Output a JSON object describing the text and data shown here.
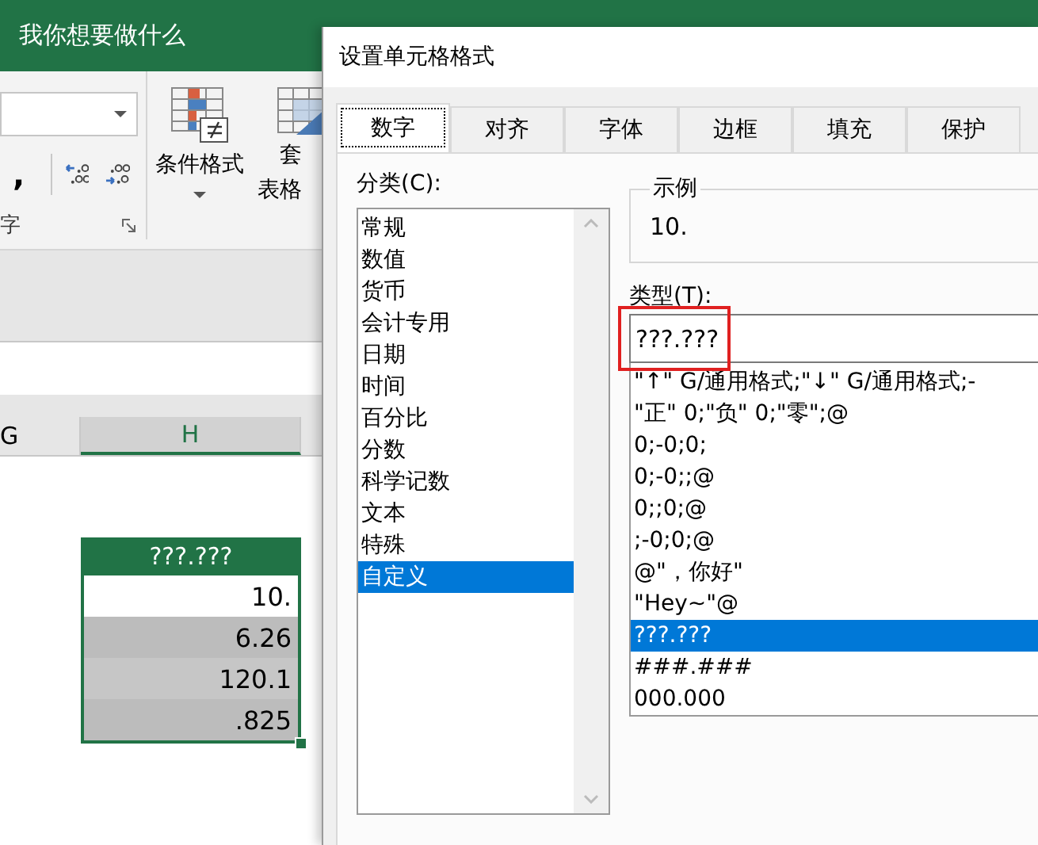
{
  "excel": {
    "tell_me": "我你想要做什么",
    "ribbon": {
      "comma_button": ",",
      "group_label": "字",
      "conditional_format": {
        "label": "条件格式"
      },
      "table_format": {
        "label_line1": "套",
        "label_line2": "表格"
      }
    },
    "column_headers": [
      {
        "label": "G",
        "selected": false
      },
      {
        "label": "H",
        "selected": true
      }
    ],
    "header_cell": "???.???",
    "cells": [
      {
        "text": "10.",
        "selected": false
      },
      {
        "text": "6.26",
        "selected": true
      },
      {
        "text": "120.1",
        "selected": true
      },
      {
        "text": ".825",
        "selected": true
      }
    ]
  },
  "dialog": {
    "title": "设置单元格格式",
    "tabs": [
      {
        "label": "数字",
        "selected": true
      },
      {
        "label": "对齐",
        "selected": false
      },
      {
        "label": "字体",
        "selected": false
      },
      {
        "label": "边框",
        "selected": false
      },
      {
        "label": "填充",
        "selected": false
      },
      {
        "label": "保护",
        "selected": false
      }
    ],
    "category_label": "分类(C):",
    "categories": [
      {
        "label": "常规",
        "selected": false
      },
      {
        "label": "数值",
        "selected": false
      },
      {
        "label": "货币",
        "selected": false
      },
      {
        "label": "会计专用",
        "selected": false
      },
      {
        "label": "日期",
        "selected": false
      },
      {
        "label": "时间",
        "selected": false
      },
      {
        "label": "百分比",
        "selected": false
      },
      {
        "label": "分数",
        "selected": false
      },
      {
        "label": "科学记数",
        "selected": false
      },
      {
        "label": "文本",
        "selected": false
      },
      {
        "label": "特殊",
        "selected": false
      },
      {
        "label": "自定义",
        "selected": true
      }
    ],
    "sample": {
      "legend": "示例",
      "value": "10."
    },
    "type_label": "类型(T):",
    "type_field": {
      "value": "???.???",
      "highlighted": true
    },
    "formats": [
      {
        "label": "\"↑\" G/通用格式;\"↓\" G/通用格式;-",
        "selected": false
      },
      {
        "label": "\"正\" 0;\"负\" 0;\"零\";@",
        "selected": false
      },
      {
        "label": "0;-0;0;",
        "selected": false
      },
      {
        "label": "0;-0;;@",
        "selected": false
      },
      {
        "label": "0;;0;@",
        "selected": false
      },
      {
        "label": ";-0;0;@",
        "selected": false
      },
      {
        "label": "@\"，你好\"",
        "selected": false
      },
      {
        "label": "\"Hey~\"@",
        "selected": false
      },
      {
        "label": "???.???",
        "selected": true
      },
      {
        "label": "###.###",
        "selected": false
      },
      {
        "label": "000.000",
        "selected": false
      }
    ]
  }
}
